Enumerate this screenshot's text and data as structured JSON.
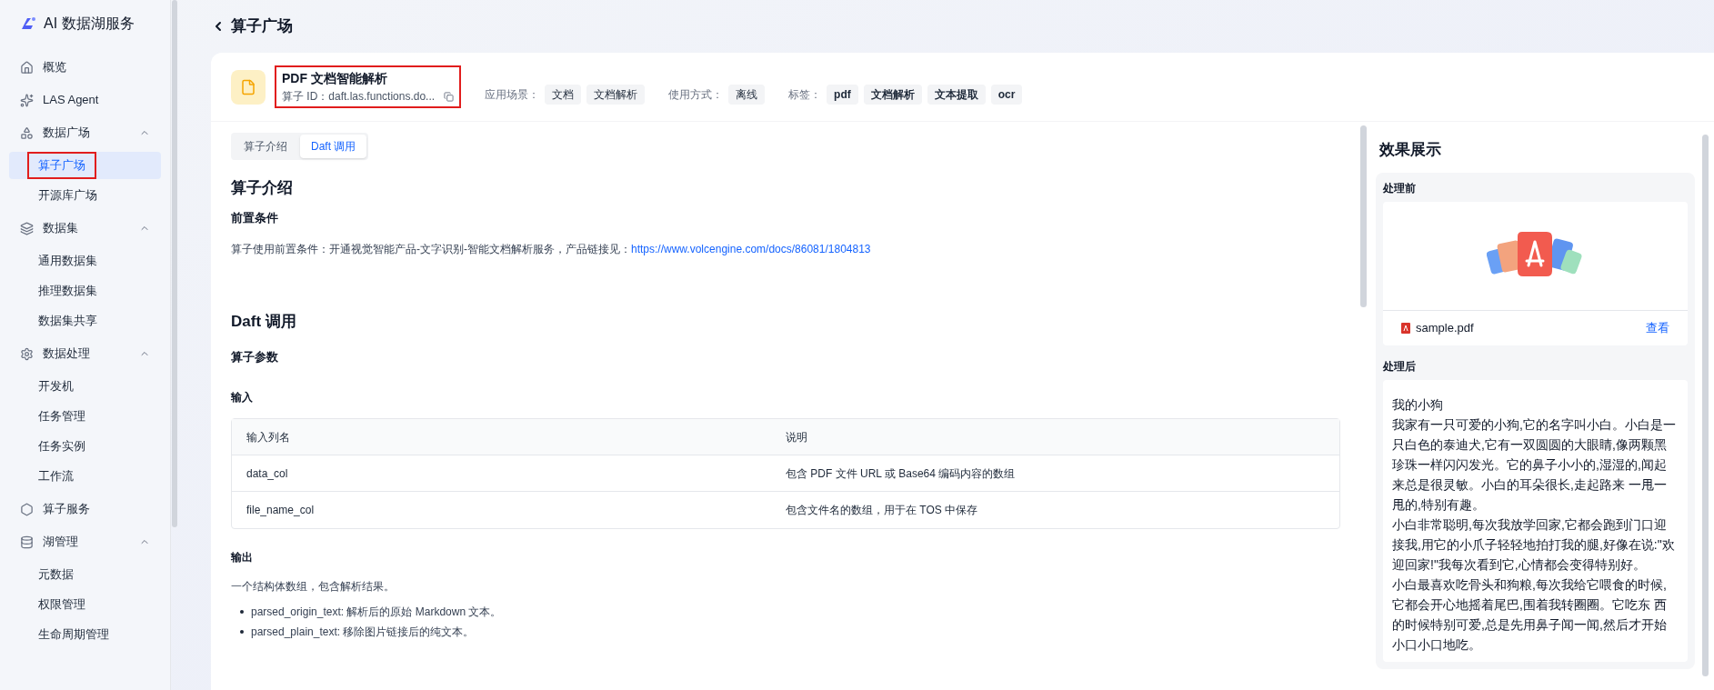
{
  "app": {
    "title": "AI 数据湖服务"
  },
  "sidebar": {
    "items": [
      {
        "label": "概览"
      },
      {
        "label": "LAS Agent"
      },
      {
        "label": "数据广场",
        "expanded": true,
        "children": [
          {
            "label": "算子广场",
            "selected": true,
            "highlighted": true
          },
          {
            "label": "开源库广场",
            "selected": false,
            "highlighted": false
          }
        ]
      },
      {
        "label": "数据集",
        "expanded": true,
        "children": [
          {
            "label": "通用数据集",
            "selected": false,
            "highlighted": false
          },
          {
            "label": "推理数据集",
            "selected": false,
            "highlighted": false
          },
          {
            "label": "数据集共享",
            "selected": false,
            "highlighted": false
          }
        ]
      },
      {
        "label": "数据处理",
        "expanded": true,
        "children": [
          {
            "label": "开发机",
            "selected": false,
            "highlighted": false
          },
          {
            "label": "任务管理",
            "selected": false,
            "highlighted": false
          },
          {
            "label": "任务实例",
            "selected": false,
            "highlighted": false
          },
          {
            "label": "工作流",
            "selected": false,
            "highlighted": false
          }
        ]
      },
      {
        "label": "算子服务"
      },
      {
        "label": "湖管理",
        "expanded": true,
        "children": [
          {
            "label": "元数据",
            "selected": false,
            "highlighted": false
          },
          {
            "label": "权限管理",
            "selected": false,
            "highlighted": false
          },
          {
            "label": "生命周期管理",
            "selected": false,
            "highlighted": false
          }
        ]
      }
    ]
  },
  "page": {
    "back_title": "算子广场"
  },
  "operator": {
    "name": "PDF 文档智能解析",
    "id_label": "算子 ID：",
    "id_value": "daft.las.functions.do...",
    "highlighted": true,
    "scenario_label": "应用场景：",
    "scenarios": [
      "文档",
      "文档解析"
    ],
    "usage_label": "使用方式：",
    "usage": [
      "离线"
    ],
    "tags_label": "标签：",
    "tags": [
      "pdf",
      "文档解析",
      "文本提取",
      "ocr"
    ]
  },
  "tabs": [
    {
      "label": "算子介绍",
      "selected": false
    },
    {
      "label": "Daft 调用",
      "selected": true
    }
  ],
  "intro": {
    "heading": "算子介绍",
    "subheading": "前置条件",
    "text": "算子使用前置条件：开通视觉智能产品-文字识别-智能文档解析服务，产品链接见：",
    "link": "https://www.volcengine.com/docs/86081/1804813"
  },
  "daft": {
    "heading": "Daft 调用",
    "params_heading": "算子参数",
    "input_heading": "输入",
    "table": {
      "columns": [
        "输入列名",
        "说明"
      ],
      "rows": [
        [
          "data_col",
          "包含 PDF 文件 URL 或 Base64 编码内容的数组"
        ],
        [
          "file_name_col",
          "包含文件名的数组，用于在 TOS 中保存"
        ]
      ]
    },
    "output_heading": "输出",
    "output_text": "一个结构体数组，包含解析结果。",
    "bullets": [
      "parsed_origin_text: 解析后的原始 Markdown 文本。",
      "parsed_plain_text: 移除图片链接后的纯文本。"
    ]
  },
  "preview": {
    "title": "效果展示",
    "before_label": "处理前",
    "file_name": "sample.pdf",
    "view_link": "查看",
    "after_label": "处理后",
    "after_paragraphs": [
      "我的小狗",
      "我家有一只可爱的小狗,它的名字叫小白。小白是一只白色的泰迪犬,它有一双圆圆的大眼睛,像两颗黑珍珠一样闪闪发光。它的鼻子小小的,湿湿的,闻起来总是很灵敏。小白的耳朵很长,走起路来 一甩一甩的,特别有趣。",
      "小白非常聪明,每次我放学回家,它都会跑到门口迎接我,用它的小爪子轻轻地拍打我的腿,好像在说:\"欢迎回家!\"我每次看到它,心情都会变得特别好。",
      "小白最喜欢吃骨头和狗粮,每次我给它喂食的时候,它都会开心地摇着尾巴,围着我转圈圈。它吃东 西的时候特别可爱,总是先用鼻子闻一闻,然后才开始小口小口地吃。"
    ]
  }
}
